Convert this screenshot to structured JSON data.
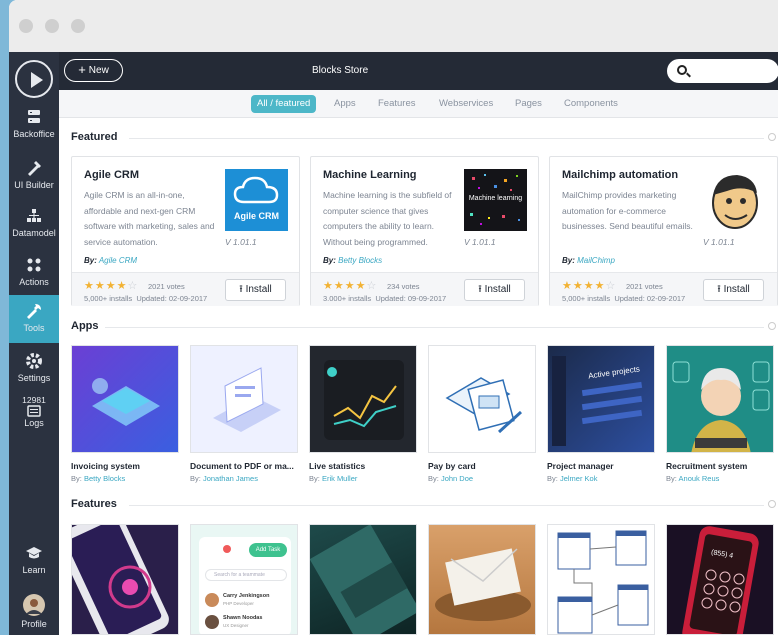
{
  "window": {
    "title": "Blocks Store"
  },
  "topbar": {
    "new_label": "New",
    "search_placeholder": ""
  },
  "sidebar": [
    {
      "label": "Backoffice",
      "icon": "backoffice-icon"
    },
    {
      "label": "UI Builder",
      "icon": "ui-builder-icon"
    },
    {
      "label": "Datamodel",
      "icon": "datamodel-icon"
    },
    {
      "label": "Actions",
      "icon": "actions-icon"
    },
    {
      "label": "Tools",
      "icon": "tools-icon",
      "active": true
    },
    {
      "label": "Settings",
      "icon": "settings-icon"
    },
    {
      "label": "Logs",
      "icon": "logs-icon",
      "count": "12981"
    },
    {
      "label": "Learn",
      "icon": "learn-icon"
    },
    {
      "label": "Profile",
      "icon": "avatar"
    }
  ],
  "tabs": [
    "All / featured",
    "Apps",
    "Features",
    "Webservices",
    "Pages",
    "Components"
  ],
  "sections": {
    "featured": "Featured",
    "apps": "Apps",
    "features": "Features"
  },
  "featured": [
    {
      "title": "Agile CRM",
      "desc": "Agile CRM is an all-in-one, affordable and next-gen CRM software with marketing, sales and service automation.",
      "version": "V 1.01.1",
      "by_label": "By:",
      "author": "Agile CRM",
      "logo_text": "Agile CRM",
      "rating": 4,
      "votes": "2021 votes",
      "installs": "5,000+ installs",
      "updated": "Updated: 02-09-2017",
      "install_label": "Install"
    },
    {
      "title": "Machine Learning",
      "desc": "Machine learning is the subfield of computer science that gives computers the ability to learn. Without being programmed.",
      "version": "V 1.01.1",
      "by_label": "By:",
      "author": "Betty Blocks",
      "logo_text": "Machine learning",
      "rating": 4,
      "votes": "234 votes",
      "installs": "3.000+ installs",
      "updated": "Updated: 09-09-2017",
      "install_label": "Install"
    },
    {
      "title": "Mailchimp automation",
      "desc": "MailChimp provides marketing automation for e-commerce businesses. Send beautiful emails.",
      "version": "V 1.01.1",
      "by_label": "By:",
      "author": "MailChimp",
      "logo_text": "",
      "rating": 4,
      "votes": "2021 votes",
      "installs": "5,000+ installs",
      "updated": "Updated: 02-09-2017",
      "install_label": "Install"
    }
  ],
  "apps": [
    {
      "name": "Invoicing system",
      "by": "By:",
      "author": "Betty Blocks"
    },
    {
      "name": "Document to PDF or ma...",
      "by": "By:",
      "author": "Jonathan James"
    },
    {
      "name": "Live statistics",
      "by": "By:",
      "author": "Erik Muller"
    },
    {
      "name": "Pay by card",
      "by": "By:",
      "author": "John Doe"
    },
    {
      "name": "Project manager",
      "by": "By:",
      "author": "Jelmer Kok"
    },
    {
      "name": "Recruitment system",
      "by": "By:",
      "author": "Anouk Reus"
    }
  ],
  "feature_thumbs": {
    "add_task": "Add Task",
    "search_teammate": "Search for a teammate",
    "person1": "Carry Jenkingson",
    "person1_role": "PHP Developer",
    "person2": "Shawn Noodas",
    "person2_role": "UX Designer",
    "active_projects": "Active projects",
    "phone_number": "(855) 4"
  },
  "colors": {
    "accent": "#4db7c8",
    "sidebar": "#2b3240",
    "topbar": "#242a36",
    "star": "#f2b233",
    "link": "#3aa7c2"
  }
}
